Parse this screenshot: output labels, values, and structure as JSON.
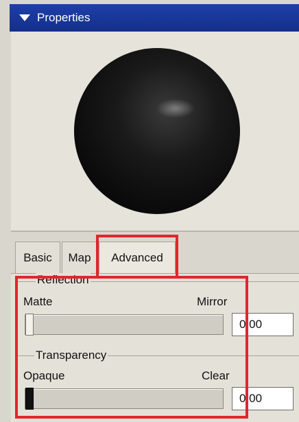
{
  "panel": {
    "title": "Properties"
  },
  "tabs": [
    {
      "label": "Basic"
    },
    {
      "label": "Map"
    },
    {
      "label": "Advanced"
    }
  ],
  "reflection": {
    "group_label": "Reflection",
    "min_label": "Matte",
    "max_label": "Mirror",
    "value": "0.00",
    "level": 0.0
  },
  "transparency": {
    "group_label": "Transparency",
    "min_label": "Opaque",
    "max_label": "Clear",
    "value": "0.00",
    "level": 0.0
  },
  "colors": {
    "titlebar": "#1e3fa8",
    "highlight": "#e0262c",
    "sphere": "#0b0b0b"
  }
}
